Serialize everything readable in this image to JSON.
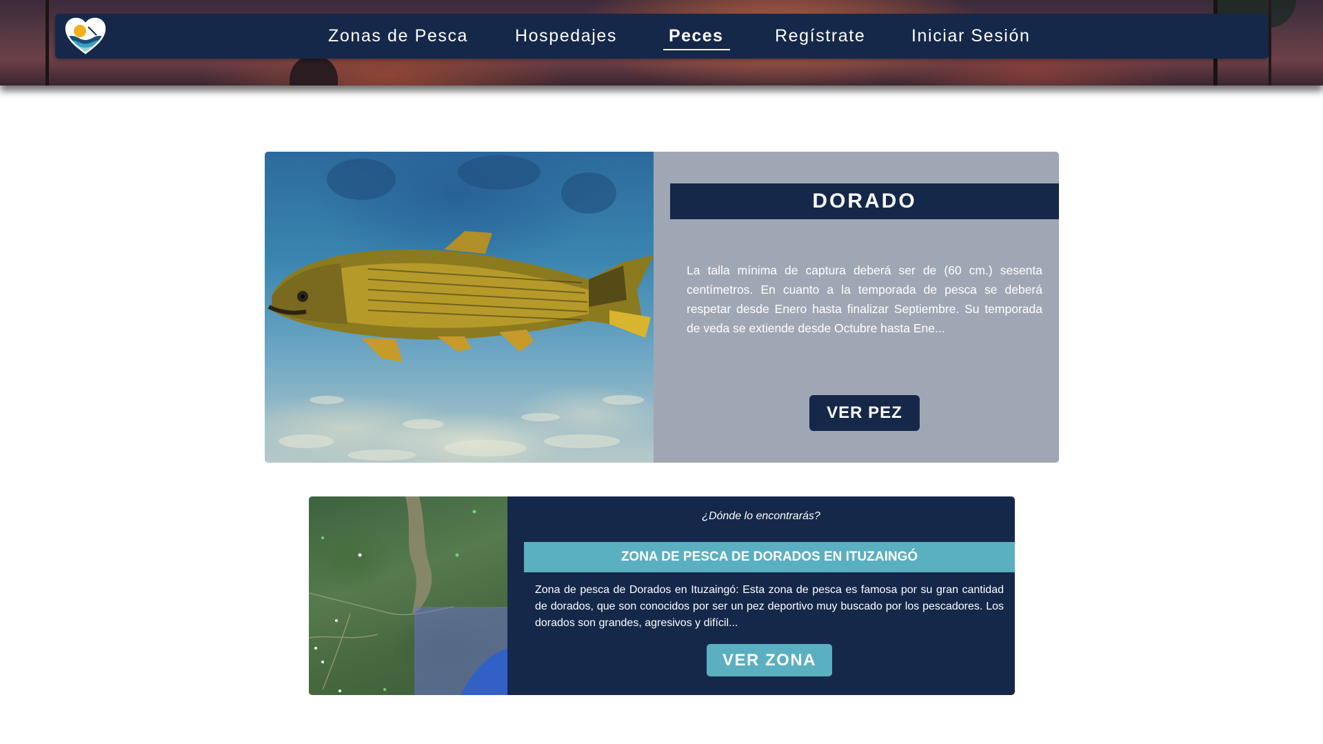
{
  "nav": {
    "logo_icon": "heart-wave-logo-icon",
    "items": [
      {
        "label": "Zonas de Pesca"
      },
      {
        "label": "Hospedajes"
      },
      {
        "label": "Peces",
        "active": true
      },
      {
        "label": "Regístrate"
      },
      {
        "label": "Iniciar Sesión"
      }
    ]
  },
  "fish": {
    "title": "DORADO",
    "description": "La talla mínima de captura deberá ser de (60 cm.) sesenta centímetros. En cuanto a la temporada de pesca se deberá respetar desde Enero hasta finalizar Septiembre. Su temporada de veda se extiende desde Octubre hasta Ene...",
    "button_label": "VER PEZ"
  },
  "zone": {
    "subtitle": "¿Dónde lo encontrarás?",
    "title": "ZONA DE PESCA DE DORADOS EN ITUZAINGÓ",
    "description": "Zona de pesca de Dorados en Ituzaingó: Esta zona de pesca es famosa por su gran cantidad de dorados, que son conocidos por ser un pez deportivo muy buscado por los pescadores. Los dorados son grandes, agresivos y difícil...",
    "button_label": "VER ZONA"
  },
  "colors": {
    "navy": "#15284a",
    "card_grey": "#a0a7b4",
    "teal": "#5aafc1",
    "white": "#ffffff"
  }
}
